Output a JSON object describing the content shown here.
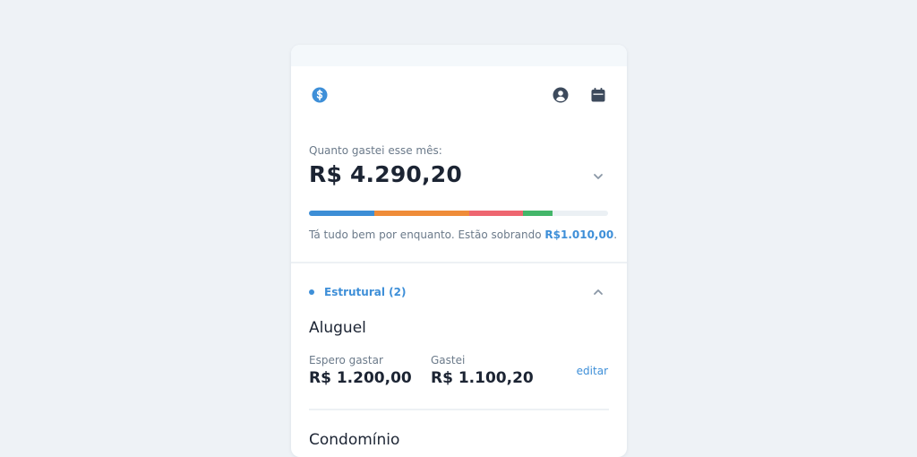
{
  "summary": {
    "label": "Quanto gastei esse mês:",
    "total": "R$ 4.290,20",
    "status_prefix": "Tá tudo bem por enquanto. Estão sobrando ",
    "status_amount": "R$1.010,00",
    "status_suffix": ".",
    "progress_segments": [
      {
        "category": "blue",
        "color": "#3d8ed6",
        "fraction": 0.219
      },
      {
        "category": "orange",
        "color": "#ef8c39",
        "fraction": 0.317
      },
      {
        "category": "red",
        "color": "#ee6670",
        "fraction": 0.179
      },
      {
        "category": "green",
        "color": "#44b66a",
        "fraction": 0.1
      }
    ],
    "progress_track_color": "#ebf0f4"
  },
  "header": {
    "logo_icon": "dollar-coin-icon",
    "profile_icon": "user-circle-icon",
    "calendar_icon": "calendar-icon"
  },
  "section": {
    "title": "Estrutural (2)",
    "dot_color": "#3e8fd8",
    "expanded": true,
    "items": [
      {
        "name": "Aluguel",
        "expected_label": "Espero gastar",
        "expected_value": "R$ 1.200,00",
        "spent_label": "Gastei",
        "spent_value": "R$ 1.100,20",
        "edit_label": "editar"
      },
      {
        "name": "Condomínio"
      }
    ]
  },
  "colors": {
    "accent": "#3e8fd8",
    "icon_dark": "#3d4a5c",
    "background": "#eef2f6"
  }
}
